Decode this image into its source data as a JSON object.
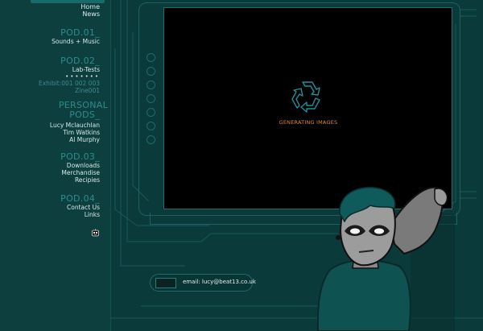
{
  "top_links": [
    "Home",
    "News"
  ],
  "pods": [
    {
      "title": "POD.01_",
      "items": [
        "Sounds + Music"
      ]
    },
    {
      "title": "POD.02_",
      "items": [
        "Lab-Tests"
      ],
      "dots": "•••••••",
      "extra": [
        "Exhibit:001 002 003",
        "Zine001"
      ]
    },
    {
      "title_lines": [
        "PERSONAL",
        "PODS_"
      ],
      "items": [
        "Lucy Mclauchlan",
        "Tim Watkins",
        "Al Murphy"
      ]
    },
    {
      "title": "POD.03_",
      "items": [
        "Downloads",
        "Merchandise",
        "Recipies"
      ]
    },
    {
      "title": "POD.04_",
      "items": [
        "Contact Us",
        "Links"
      ]
    }
  ],
  "screen": {
    "status": "GENERATING IMAGES"
  },
  "email": {
    "text": "email: lucy@beat13.co.uk"
  },
  "colors": {
    "bg": "#0b3a3a",
    "accent": "#2e8c8c",
    "status": "#e08a1c"
  },
  "icons": {
    "loader": "recycle-arrows-icon",
    "mascot": "robot-head-icon"
  }
}
